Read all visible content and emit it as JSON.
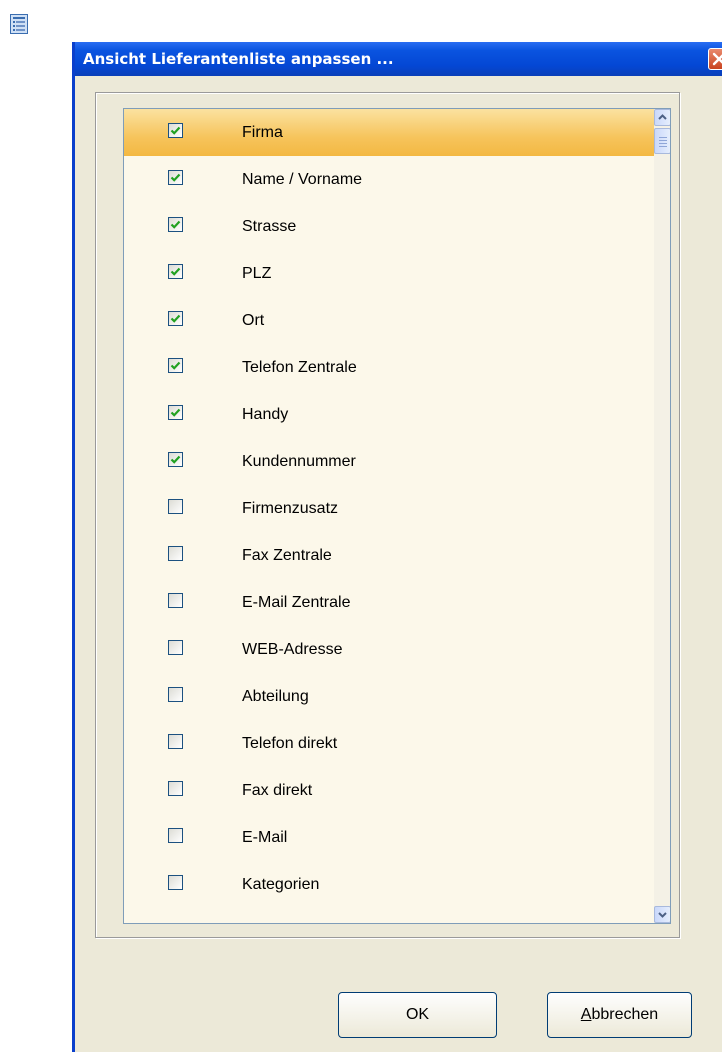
{
  "window": {
    "title": "Ansicht Lieferantenliste anpassen ..."
  },
  "items": [
    {
      "label": "Firma",
      "checked": true,
      "selected": true
    },
    {
      "label": "Name / Vorname",
      "checked": true
    },
    {
      "label": "Strasse",
      "checked": true
    },
    {
      "label": "PLZ",
      "checked": true
    },
    {
      "label": "Ort",
      "checked": true
    },
    {
      "label": "Telefon Zentrale",
      "checked": true
    },
    {
      "label": "Handy",
      "checked": true
    },
    {
      "label": "Kundennummer",
      "checked": true
    },
    {
      "label": "Firmenzusatz",
      "checked": false
    },
    {
      "label": "Fax Zentrale",
      "checked": false
    },
    {
      "label": "E-Mail Zentrale",
      "checked": false
    },
    {
      "label": "WEB-Adresse",
      "checked": false
    },
    {
      "label": "Abteilung",
      "checked": false
    },
    {
      "label": "Telefon direkt",
      "checked": false
    },
    {
      "label": "Fax direkt",
      "checked": false
    },
    {
      "label": "E-Mail",
      "checked": false
    },
    {
      "label": "Kategorien",
      "checked": false
    }
  ],
  "buttons": {
    "ok": "OK",
    "cancel_mnemonic": "A",
    "cancel_rest": "bbrechen"
  },
  "icons": {
    "app": "list-view-icon",
    "close": "close-icon",
    "scroll_up": "chevron-up-icon",
    "scroll_down": "chevron-down-icon",
    "check": "checkmark-icon"
  },
  "colors": {
    "title_bar": "#0447d4",
    "selection": "#f6c45c",
    "list_background": "#fcf8ea",
    "check_mark": "#21a121",
    "dialog_face": "#ece9d8"
  }
}
